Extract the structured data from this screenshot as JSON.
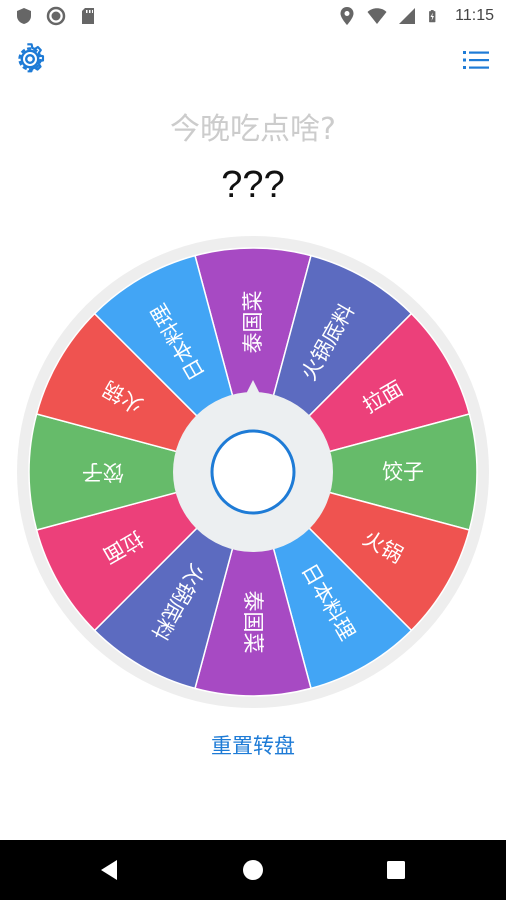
{
  "status_bar": {
    "time": "11:15",
    "icons_left": [
      "shield-icon",
      "circle-notification-icon",
      "sd-card-icon"
    ],
    "icons_right": [
      "location-icon",
      "wifi-icon",
      "signal-icon",
      "battery-charging-icon"
    ]
  },
  "header": {
    "settings_icon": "gear-icon",
    "menu_icon": "list-icon",
    "accent_color": "#1e7bd6"
  },
  "question": "今晚吃点啥?",
  "result": "???",
  "wheel": {
    "segments": [
      {
        "label": "泰国菜",
        "color": "#a74ac3"
      },
      {
        "label": "火锅底料",
        "color": "#5c6bc0"
      },
      {
        "label": "拉面",
        "color": "#ec407a"
      },
      {
        "label": "饺子",
        "color": "#66bb6a"
      },
      {
        "label": "火锅",
        "color": "#ef5350"
      },
      {
        "label": "日本料理",
        "color": "#42a5f5"
      },
      {
        "label": "泰国菜",
        "color": "#a74ac3"
      },
      {
        "label": "火锅底料",
        "color": "#5c6bc0"
      },
      {
        "label": "拉面",
        "color": "#ec407a"
      },
      {
        "label": "饺子",
        "color": "#66bb6a"
      },
      {
        "label": "火锅",
        "color": "#ef5350"
      },
      {
        "label": "日本料理",
        "color": "#42a5f5"
      }
    ],
    "rim_color": "#eeeeee",
    "hub_color": "#eceff1",
    "center_button_border": "#1e7bd6"
  },
  "reset_label": "重置转盘",
  "nav": {
    "back_icon": "back-triangle-icon",
    "home_icon": "home-circle-icon",
    "recents_icon": "recents-square-icon"
  }
}
